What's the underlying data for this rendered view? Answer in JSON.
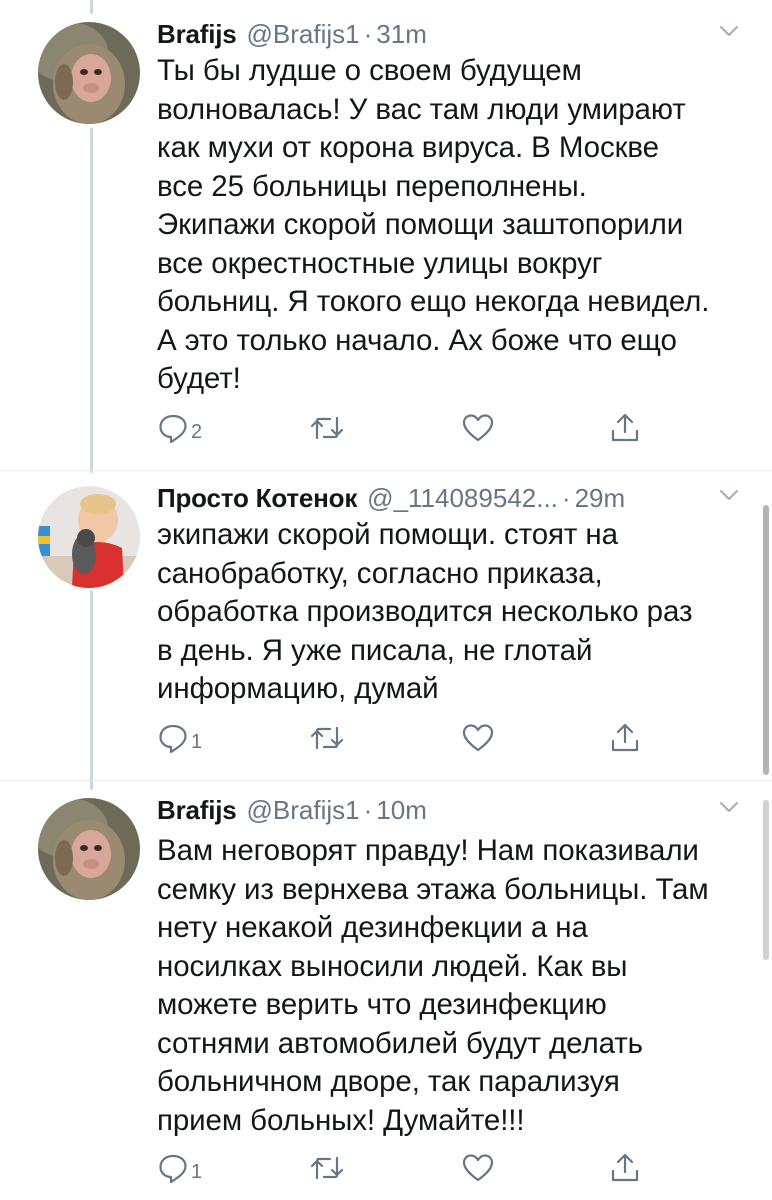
{
  "tweets": [
    {
      "name": "Brafijs",
      "handle": "@Brafijs1",
      "separator": "·",
      "time": "31m",
      "avatar": "monkey-avatar",
      "lines": [
        "Ты бы лудше о своем будущем",
        "волновалась! У вас там люди умирают",
        "как мухи от корона вируса. В Москве",
        "все 25 больницы переполнены.",
        "Экипажи скорой помощи заштопорили",
        "все окрестностные улицы вокруг",
        "больниц. Я токого ещо некогда невидел.",
        "А это только начало. Ах боже что ещо",
        "будет!"
      ],
      "reply_count": "2"
    },
    {
      "name": "Просто Котенок",
      "handle": "@_114089542...",
      "separator": "·",
      "time": "29m",
      "avatar": "child-with-cat-avatar",
      "lines": [
        "экипажи скорой помощи. стоят на",
        "санобработку, согласно приказа,",
        "обработка производится несколько раз",
        "в день. Я уже писала, не глотай",
        "информацию, думай"
      ],
      "reply_count": "1"
    },
    {
      "name": "Brafijs",
      "handle": "@Brafijs1",
      "separator": "·",
      "time": "10m",
      "avatar": "monkey-avatar",
      "lines": [
        "Вам неговорят правду! Нам показивали",
        "семку из вернхева этажа больницы. Там",
        "нету некакой дезинфекции а на",
        "носилках выносили людей. Как вы",
        "можете верить что дезинфекцию",
        "сотнями автомобилей будут делать",
        "больничном дворе, так парализуя",
        "прием больных! Думайте!!!"
      ],
      "reply_count": "1"
    }
  ],
  "icons": {
    "reply": "reply-icon",
    "retweet": "retweet-icon",
    "like": "heart-icon",
    "share": "share-icon",
    "menu": "chevron-down-icon"
  },
  "colors": {
    "text": "#14171a",
    "secondary": "#657786",
    "thread_line": "#ccd6dd",
    "separator": "#e6ecf0"
  }
}
